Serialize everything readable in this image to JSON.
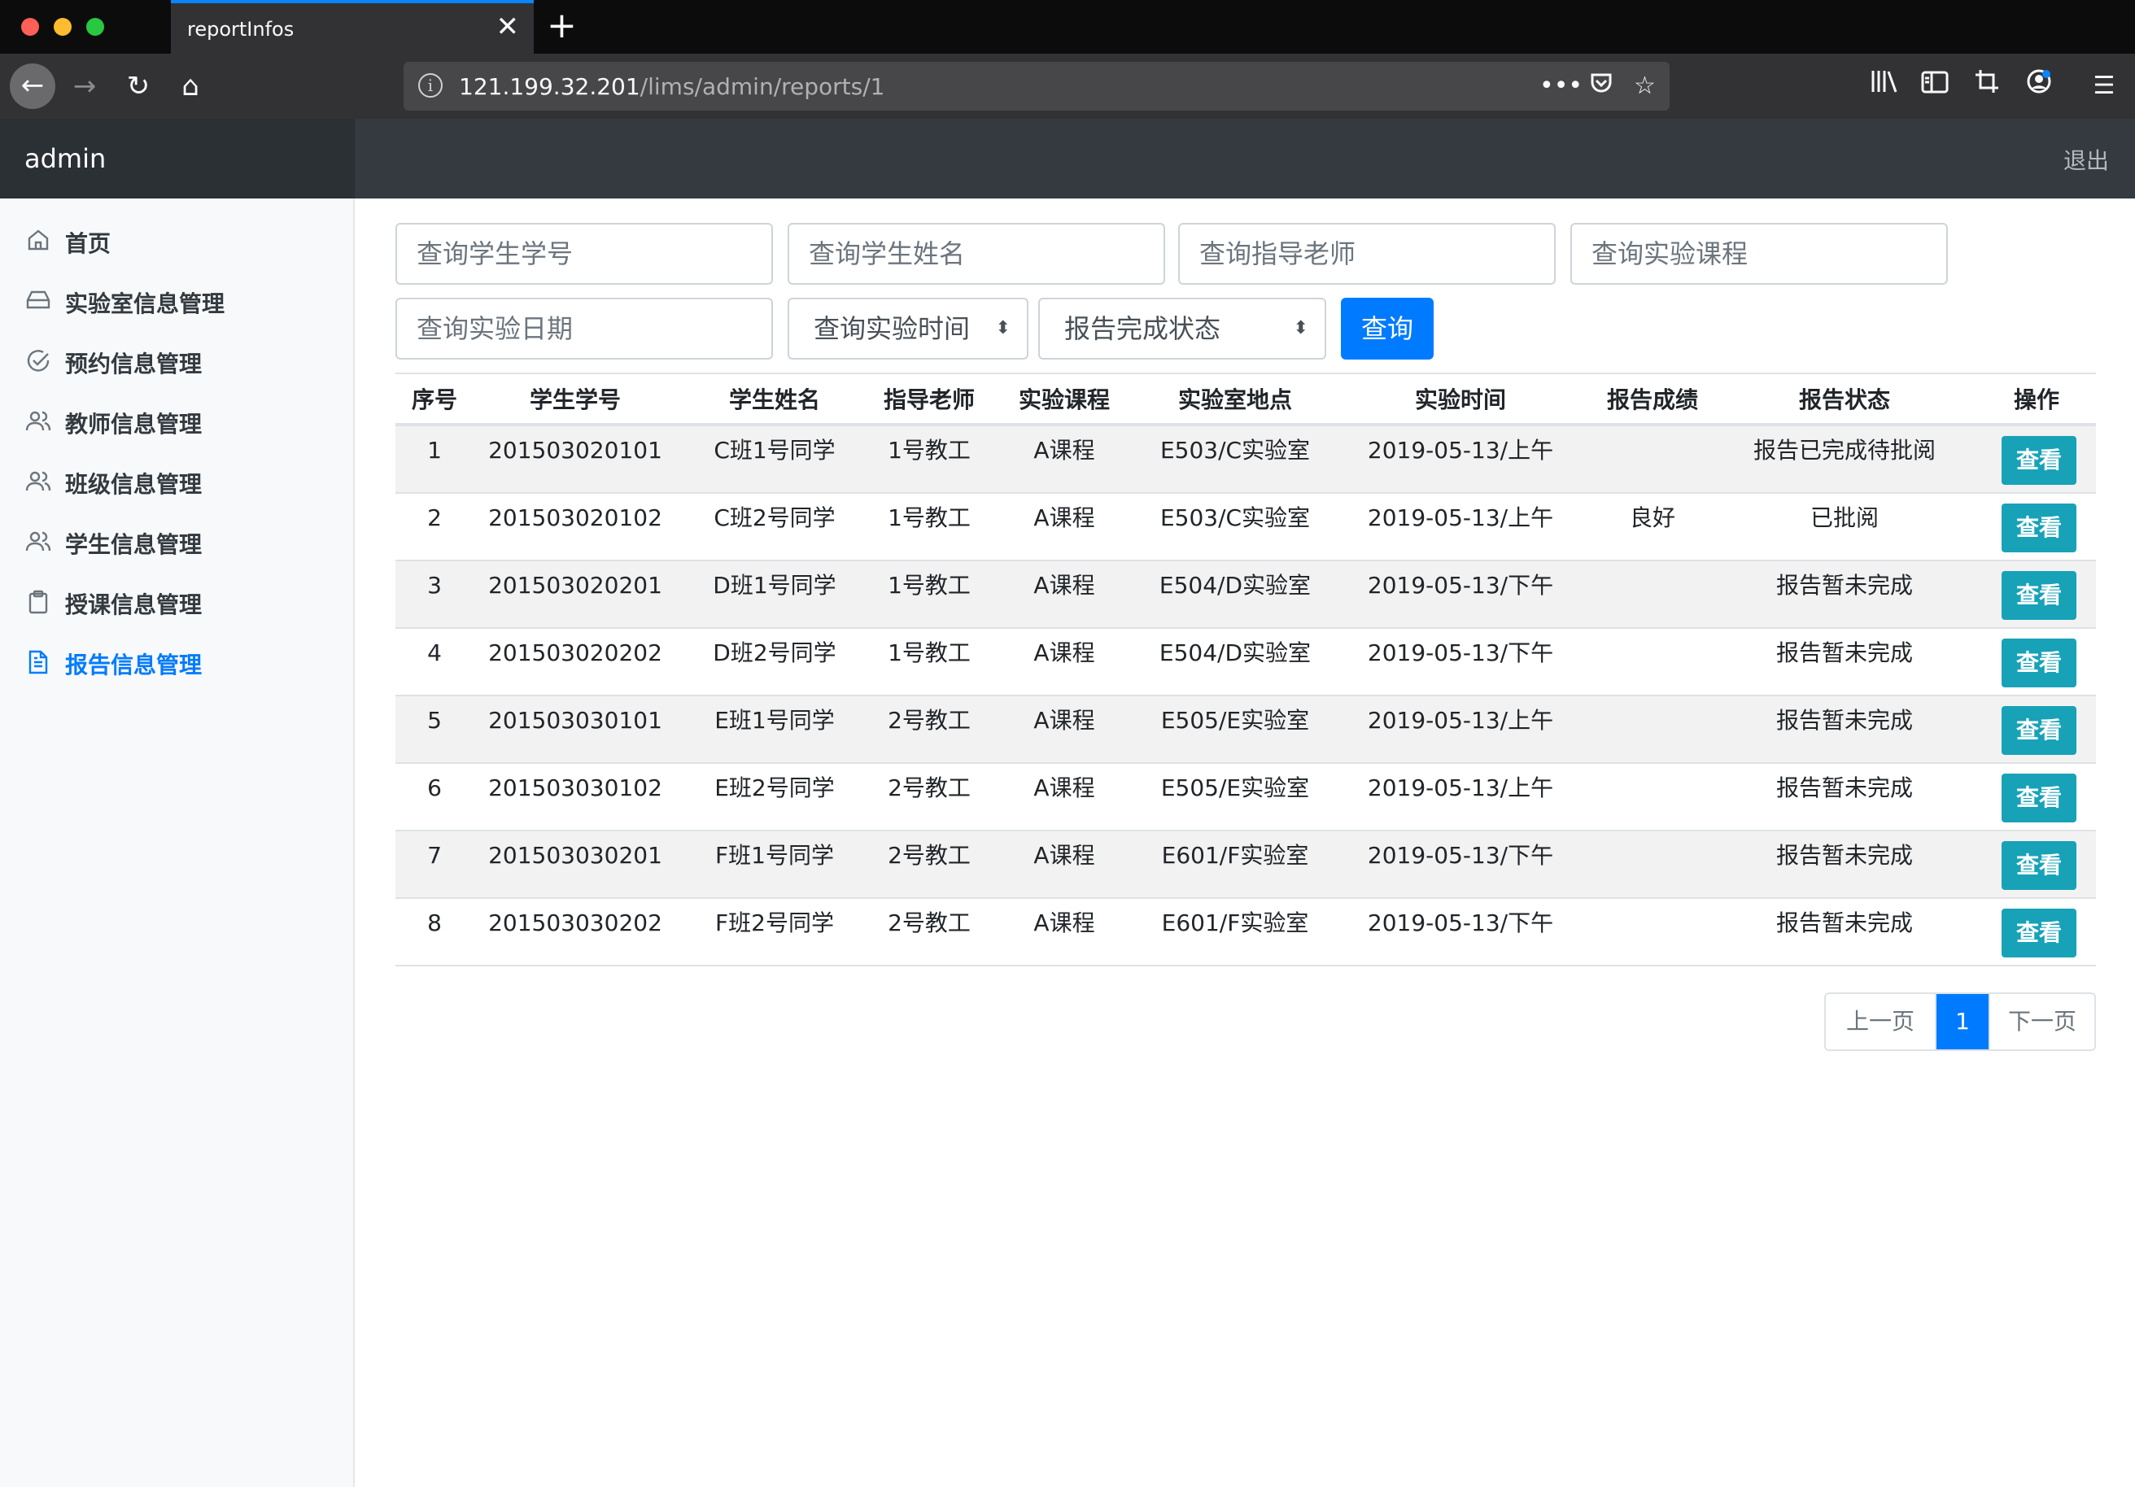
{
  "browser": {
    "tab_title": "reportInfos",
    "tab_close": "✕",
    "new_tab": "+",
    "url_host": "121.199.32.201",
    "url_path": "/lims/admin/reports/1",
    "page_actions": "•••"
  },
  "header": {
    "brand": "admin",
    "logout": "退出"
  },
  "sidebar": {
    "items": [
      {
        "label": "首页",
        "icon": "home-icon"
      },
      {
        "label": "实验室信息管理",
        "icon": "drive-icon"
      },
      {
        "label": "预约信息管理",
        "icon": "check-circle-icon"
      },
      {
        "label": "教师信息管理",
        "icon": "users-icon"
      },
      {
        "label": "班级信息管理",
        "icon": "users-icon"
      },
      {
        "label": "学生信息管理",
        "icon": "users-icon"
      },
      {
        "label": "授课信息管理",
        "icon": "clipboard-icon"
      },
      {
        "label": "报告信息管理",
        "icon": "file-text-icon"
      }
    ],
    "active_index": 7
  },
  "filters": {
    "student_id_placeholder": "查询学生学号",
    "student_name_placeholder": "查询学生姓名",
    "teacher_placeholder": "查询指导老师",
    "course_placeholder": "查询实验课程",
    "date_placeholder": "查询实验日期",
    "time_select": "查询实验时间",
    "status_select": "报告完成状态",
    "query_button": "查询"
  },
  "table": {
    "headers": [
      "序号",
      "学生学号",
      "学生姓名",
      "指导老师",
      "实验课程",
      "实验室地点",
      "实验时间",
      "报告成绩",
      "报告状态",
      "操作"
    ],
    "rows": [
      {
        "no": "1",
        "sid": "201503020101",
        "name": "C班1号同学",
        "teacher": "1号教工",
        "course": "A课程",
        "lab": "E503/C实验室",
        "time": "2019-05-13/上午",
        "score": "",
        "status": "报告已完成待批阅",
        "action": "查看"
      },
      {
        "no": "2",
        "sid": "201503020102",
        "name": "C班2号同学",
        "teacher": "1号教工",
        "course": "A课程",
        "lab": "E503/C实验室",
        "time": "2019-05-13/上午",
        "score": "良好",
        "status": "已批阅",
        "action": "查看"
      },
      {
        "no": "3",
        "sid": "201503020201",
        "name": "D班1号同学",
        "teacher": "1号教工",
        "course": "A课程",
        "lab": "E504/D实验室",
        "time": "2019-05-13/下午",
        "score": "",
        "status": "报告暂未完成",
        "action": "查看"
      },
      {
        "no": "4",
        "sid": "201503020202",
        "name": "D班2号同学",
        "teacher": "1号教工",
        "course": "A课程",
        "lab": "E504/D实验室",
        "time": "2019-05-13/下午",
        "score": "",
        "status": "报告暂未完成",
        "action": "查看"
      },
      {
        "no": "5",
        "sid": "201503030101",
        "name": "E班1号同学",
        "teacher": "2号教工",
        "course": "A课程",
        "lab": "E505/E实验室",
        "time": "2019-05-13/上午",
        "score": "",
        "status": "报告暂未完成",
        "action": "查看"
      },
      {
        "no": "6",
        "sid": "201503030102",
        "name": "E班2号同学",
        "teacher": "2号教工",
        "course": "A课程",
        "lab": "E505/E实验室",
        "time": "2019-05-13/上午",
        "score": "",
        "status": "报告暂未完成",
        "action": "查看"
      },
      {
        "no": "7",
        "sid": "201503030201",
        "name": "F班1号同学",
        "teacher": "2号教工",
        "course": "A课程",
        "lab": "E601/F实验室",
        "time": "2019-05-13/下午",
        "score": "",
        "status": "报告暂未完成",
        "action": "查看"
      },
      {
        "no": "8",
        "sid": "201503030202",
        "name": "F班2号同学",
        "teacher": "2号教工",
        "course": "A课程",
        "lab": "E601/F实验室",
        "time": "2019-05-13/下午",
        "score": "",
        "status": "报告暂未完成",
        "action": "查看"
      }
    ]
  },
  "pagination": {
    "prev": "上一页",
    "current": "1",
    "next": "下一页"
  },
  "colors": {
    "primary": "#007bff",
    "info": "#17a2b8",
    "header_bg": "#343a40"
  }
}
